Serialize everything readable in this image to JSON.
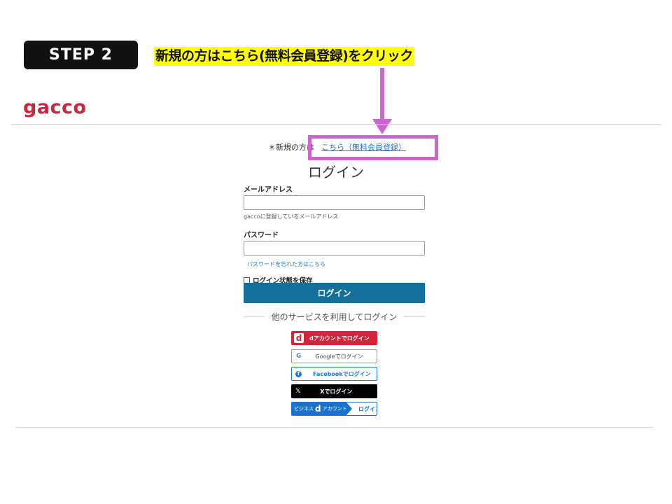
{
  "overlay": {
    "step_label": "STEP 2",
    "instruction": "新規の方はこちら(無料会員登録)をクリック",
    "highlight_color": "#cc66cc",
    "marker_color": "#ffff00"
  },
  "header": {
    "logo_text": "gacco",
    "logo_color": "#c8283a"
  },
  "signup": {
    "prefix": "＊新規の方は",
    "link": "こちら（無料会員登録）"
  },
  "login": {
    "title": "ログイン",
    "email_label": "メールアドレス",
    "email_value": "",
    "email_hint": "gaccoに登録しているメールアドレス",
    "password_label": "パスワード",
    "password_value": "",
    "forgot_link": "パスワードを忘れた方はこちら",
    "remember_label": "ログイン状態を保存",
    "remember_checked": false,
    "submit_label": "ログイン",
    "submit_color": "#156f9b"
  },
  "social": {
    "separator": "他のサービスを利用してログイン",
    "buttons": [
      {
        "label": "dアカウントでログイン",
        "icon": "d-account-icon",
        "color": "#d8223a"
      },
      {
        "label": "Googleでログイン",
        "icon": "google-icon"
      },
      {
        "label": "Facebookでログイン",
        "icon": "facebook-icon",
        "color": "#1877f2"
      },
      {
        "label": "Xでログイン",
        "icon": "x-icon",
        "color": "#000000"
      },
      {
        "label_left": "ビジネス",
        "label_d": "d",
        "label_account": "アカウント",
        "label_right": "ログイン",
        "icon": "business-d-account-icon",
        "color": "#1a73c9"
      }
    ]
  }
}
